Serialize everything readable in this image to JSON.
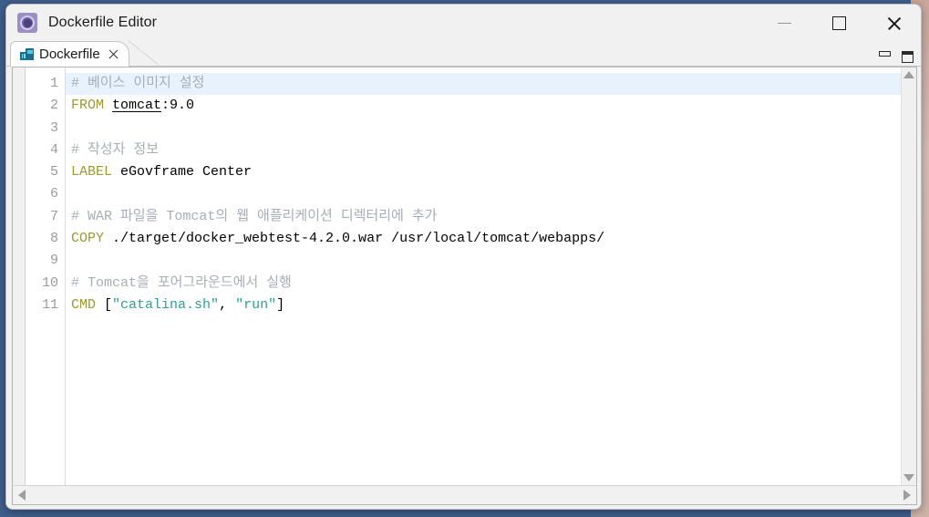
{
  "window": {
    "title": "Dockerfile Editor",
    "app_icon": "gear-icon",
    "controls": {
      "minimize": "minimize-icon",
      "maximize": "maximize-icon",
      "close": "close-icon"
    }
  },
  "tabs": [
    {
      "label": "Dockerfile",
      "icon": "dockerfile-icon",
      "close": "close-icon",
      "active": true
    }
  ],
  "view_controls": {
    "minimize": "view-minimize-icon",
    "maximize": "view-maximize-icon"
  },
  "editor": {
    "language": "dockerfile",
    "current_line": 1,
    "line_numbers": [
      "1",
      "2",
      "3",
      "4",
      "5",
      "6",
      "7",
      "8",
      "9",
      "10",
      "11"
    ],
    "lines": [
      {
        "number": "1",
        "text": "# 베이스 이미지 설정",
        "tokens": [
          {
            "type": "comment",
            "text": "# 베이스 이미지 설정"
          }
        ]
      },
      {
        "number": "2",
        "text": "FROM tomcat:9.0",
        "tokens": [
          {
            "type": "keyword",
            "text": "FROM"
          },
          {
            "type": "plain",
            "text": " "
          },
          {
            "type": "underline",
            "text": "tomcat"
          },
          {
            "type": "plain",
            "text": ":9.0"
          }
        ]
      },
      {
        "number": "3",
        "text": "",
        "tokens": []
      },
      {
        "number": "4",
        "text": "# 작성자 정보",
        "tokens": [
          {
            "type": "comment",
            "text": "# 작성자 정보"
          }
        ]
      },
      {
        "number": "5",
        "text": "LABEL eGovframe Center",
        "tokens": [
          {
            "type": "keyword",
            "text": "LABEL"
          },
          {
            "type": "plain",
            "text": " eGovframe Center"
          }
        ]
      },
      {
        "number": "6",
        "text": "",
        "tokens": []
      },
      {
        "number": "7",
        "text": "# WAR 파일을 Tomcat의 웹 애플리케이션 디렉터리에 추가",
        "tokens": [
          {
            "type": "comment",
            "text": "# WAR 파일을 Tomcat의 웹 애플리케이션 디렉터리에 추가"
          }
        ]
      },
      {
        "number": "8",
        "text": "COPY ./target/docker_webtest-4.2.0.war /usr/local/tomcat/webapps/",
        "tokens": [
          {
            "type": "keyword",
            "text": "COPY"
          },
          {
            "type": "plain",
            "text": " ./target/docker_webtest-4.2.0.war /usr/local/tomcat/webapps/"
          }
        ]
      },
      {
        "number": "9",
        "text": "",
        "tokens": []
      },
      {
        "number": "10",
        "text": "# Tomcat을 포어그라운드에서 실행",
        "tokens": [
          {
            "type": "comment",
            "text": "# Tomcat을 포어그라운드에서 실행"
          }
        ]
      },
      {
        "number": "11",
        "text": "CMD [\"catalina.sh\", \"run\"]",
        "tokens": [
          {
            "type": "keyword",
            "text": "CMD"
          },
          {
            "type": "plain",
            "text": " ["
          },
          {
            "type": "string",
            "text": "\"catalina.sh\""
          },
          {
            "type": "plain",
            "text": ", "
          },
          {
            "type": "string",
            "text": "\"run\""
          },
          {
            "type": "plain",
            "text": "]"
          }
        ]
      }
    ]
  },
  "scrollbars": {
    "vertical": {
      "up": "scroll-up-icon",
      "down": "scroll-down-icon"
    },
    "horizontal": {
      "left": "scroll-left-icon",
      "right": "scroll-right-icon"
    }
  },
  "colors": {
    "comment": "#a7adb5",
    "keyword": "#9a9a2e",
    "string": "#2aa198",
    "plain": "#000000",
    "current_line_highlight": "#e8f2fd",
    "window_chrome": "#f1f1f1",
    "desktop": "#3f5e8c"
  }
}
